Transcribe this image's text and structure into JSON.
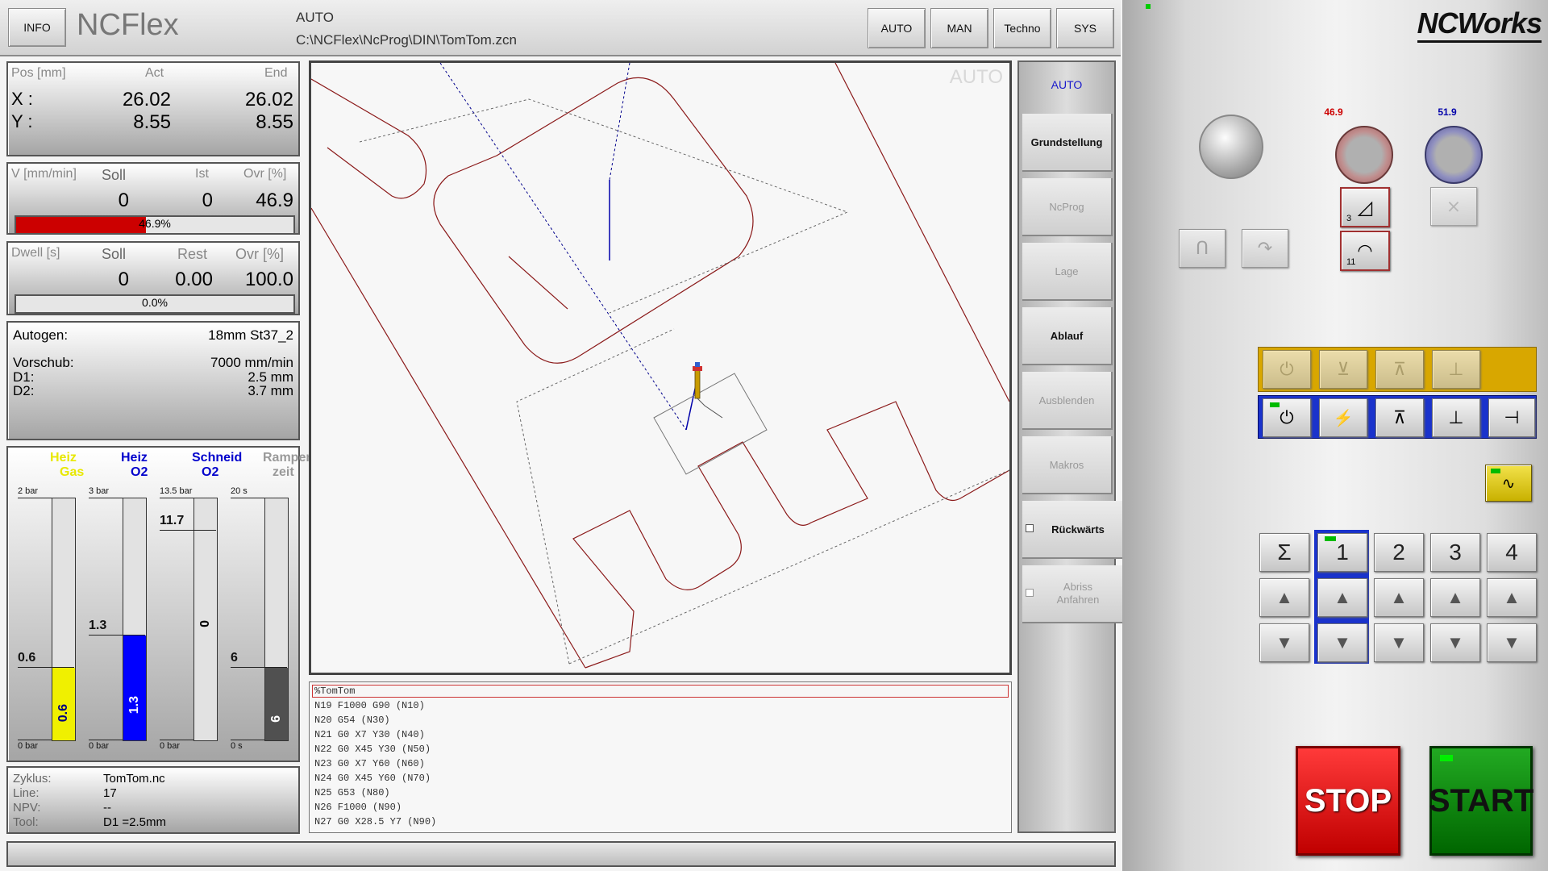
{
  "header": {
    "info_label": "INFO",
    "app_title": "NCFlex",
    "mode": "AUTO",
    "file_path": "C:\\NCFlex\\NcProg\\DIN\\TomTom.zcn",
    "nav_buttons": [
      "AUTO",
      "MAN",
      "Techno",
      "SYS"
    ]
  },
  "position": {
    "header_label": "Pos [mm]",
    "act_label": "Act",
    "end_label": "End",
    "x_label": "X :",
    "y_label": "Y :",
    "x_act": "26.02",
    "x_end": "26.02",
    "y_act": "8.55",
    "y_end": "8.55"
  },
  "velocity": {
    "header_label": "V [mm/min]",
    "soll_label": "Soll",
    "ist_label": "Ist",
    "ovr_label": "Ovr [%]",
    "soll": "0",
    "ist": "0",
    "ovr": "46.9",
    "bar_text": "46.9%",
    "bar_percent": 46.9,
    "bar_color": "#cc0000"
  },
  "dwell": {
    "header_label": "Dwell [s]",
    "soll_label": "Soll",
    "rest_label": "Rest",
    "ovr_label": "Ovr [%]",
    "soll": "0",
    "rest": "0.00",
    "ovr": "100.0",
    "bar_text": "0.0%",
    "bar_percent": 0
  },
  "process": {
    "autogen_label": "Autogen:",
    "autogen_value": "18mm St37_2",
    "vorschub_label": "Vorschub:",
    "vorschub_value": "7000 mm/min",
    "d1_label": "D1:",
    "d1_value": "2.5 mm",
    "d2_label": "D2:",
    "d2_value": "3.7 mm"
  },
  "gauges": [
    {
      "title1": "Heiz",
      "title2": "Gas",
      "color": "#e8e800",
      "max_label": "2 bar",
      "min_label": "0 bar",
      "marker": "0.6",
      "value": "0.6",
      "fraction": 0.3,
      "fill": "#f0f000",
      "text_color": "#000080"
    },
    {
      "title1": "Heiz",
      "title2": "O2",
      "color": "#0000cc",
      "max_label": "3 bar",
      "min_label": "0 bar",
      "marker": "1.3",
      "value": "1.3",
      "fraction": 0.433,
      "fill": "#0000ff",
      "text_color": "#ffffff"
    },
    {
      "title1": "Schneid",
      "title2": "O2",
      "color": "#0000cc",
      "max_label": "13.5 bar",
      "min_label": "0 bar",
      "marker": "11.7",
      "value": "0",
      "fraction": 0,
      "fill": "#0000ff",
      "text_color": "#000000"
    },
    {
      "title1": "Rampen",
      "title2": "zeit",
      "color": "#999999",
      "max_label": "20 s",
      "min_label": "0 s",
      "marker": "6",
      "value": "6",
      "fraction": 0.3,
      "fill": "#505050",
      "text_color": "#ffffff"
    }
  ],
  "cycle": {
    "zyklus_label": "Zyklus:",
    "zyklus_value": "TomTom.nc",
    "line_label": "Line:",
    "line_value": "17",
    "npv_label": "NPV:",
    "npv_value": "--",
    "tool_label": "Tool:",
    "tool_value": "D1 =2.5mm"
  },
  "drawing": {
    "watermark": "AUTO"
  },
  "program": {
    "lines": [
      "%TomTom",
      "N19 F1000 G90 (N10)",
      "N20 G54 (N30)",
      "N21 G0 X7 Y30 (N40)",
      "N22 G0 X45 Y30 (N50)",
      "N23 G0 X7 Y60 (N60)",
      "N24 G0 X45 Y60 (N70)",
      "N25 G53 (N80)",
      "N26 F1000  (N90)",
      "N27 G0 X28.5 Y7 (N90)"
    ]
  },
  "side_menu": {
    "mode": "AUTO",
    "items": [
      "Grundstellung",
      "NcProg",
      "Lage",
      "Ablauf",
      "Ausblenden",
      "Makros",
      "Rückwärts",
      "Abriss\nAnfahren"
    ]
  },
  "machine": {
    "brand": "NCWorks",
    "knob_left_value": "46.9",
    "knob_right_value": "51.9",
    "ramp_value": "3",
    "speed_value": "11",
    "program_keys": [
      "Σ",
      "1",
      "2",
      "3",
      "4"
    ],
    "stop_label": "STOP",
    "start_label": "START",
    "colors": {
      "stop": "#e00000",
      "start": "#008800",
      "highlight": "#1a33cc",
      "yellow_panel": "#d8a700"
    }
  }
}
